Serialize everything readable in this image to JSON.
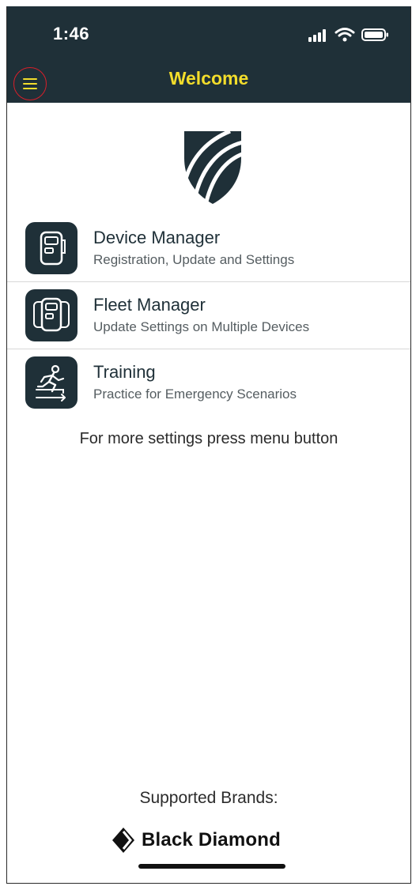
{
  "status_bar": {
    "time": "1:46"
  },
  "header": {
    "title": "Welcome",
    "menu_icon": "hamburger-menu-icon"
  },
  "menu_items": [
    {
      "icon": "device-icon",
      "title": "Device Manager",
      "subtitle": "Registration, Update and Settings"
    },
    {
      "icon": "multiple-devices-icon",
      "title": "Fleet Manager",
      "subtitle": "Update Settings on Multiple Devices"
    },
    {
      "icon": "running-person-icon",
      "title": "Training",
      "subtitle": "Practice for Emergency Scenarios"
    }
  ],
  "hint": "For more settings press menu button",
  "brands": {
    "label": "Supported Brands:",
    "brand_name": "Black Diamond"
  },
  "colors": {
    "primary": "#1f3038",
    "title_accent": "#f3dd2b",
    "menu_ring": "#d81f2a"
  }
}
